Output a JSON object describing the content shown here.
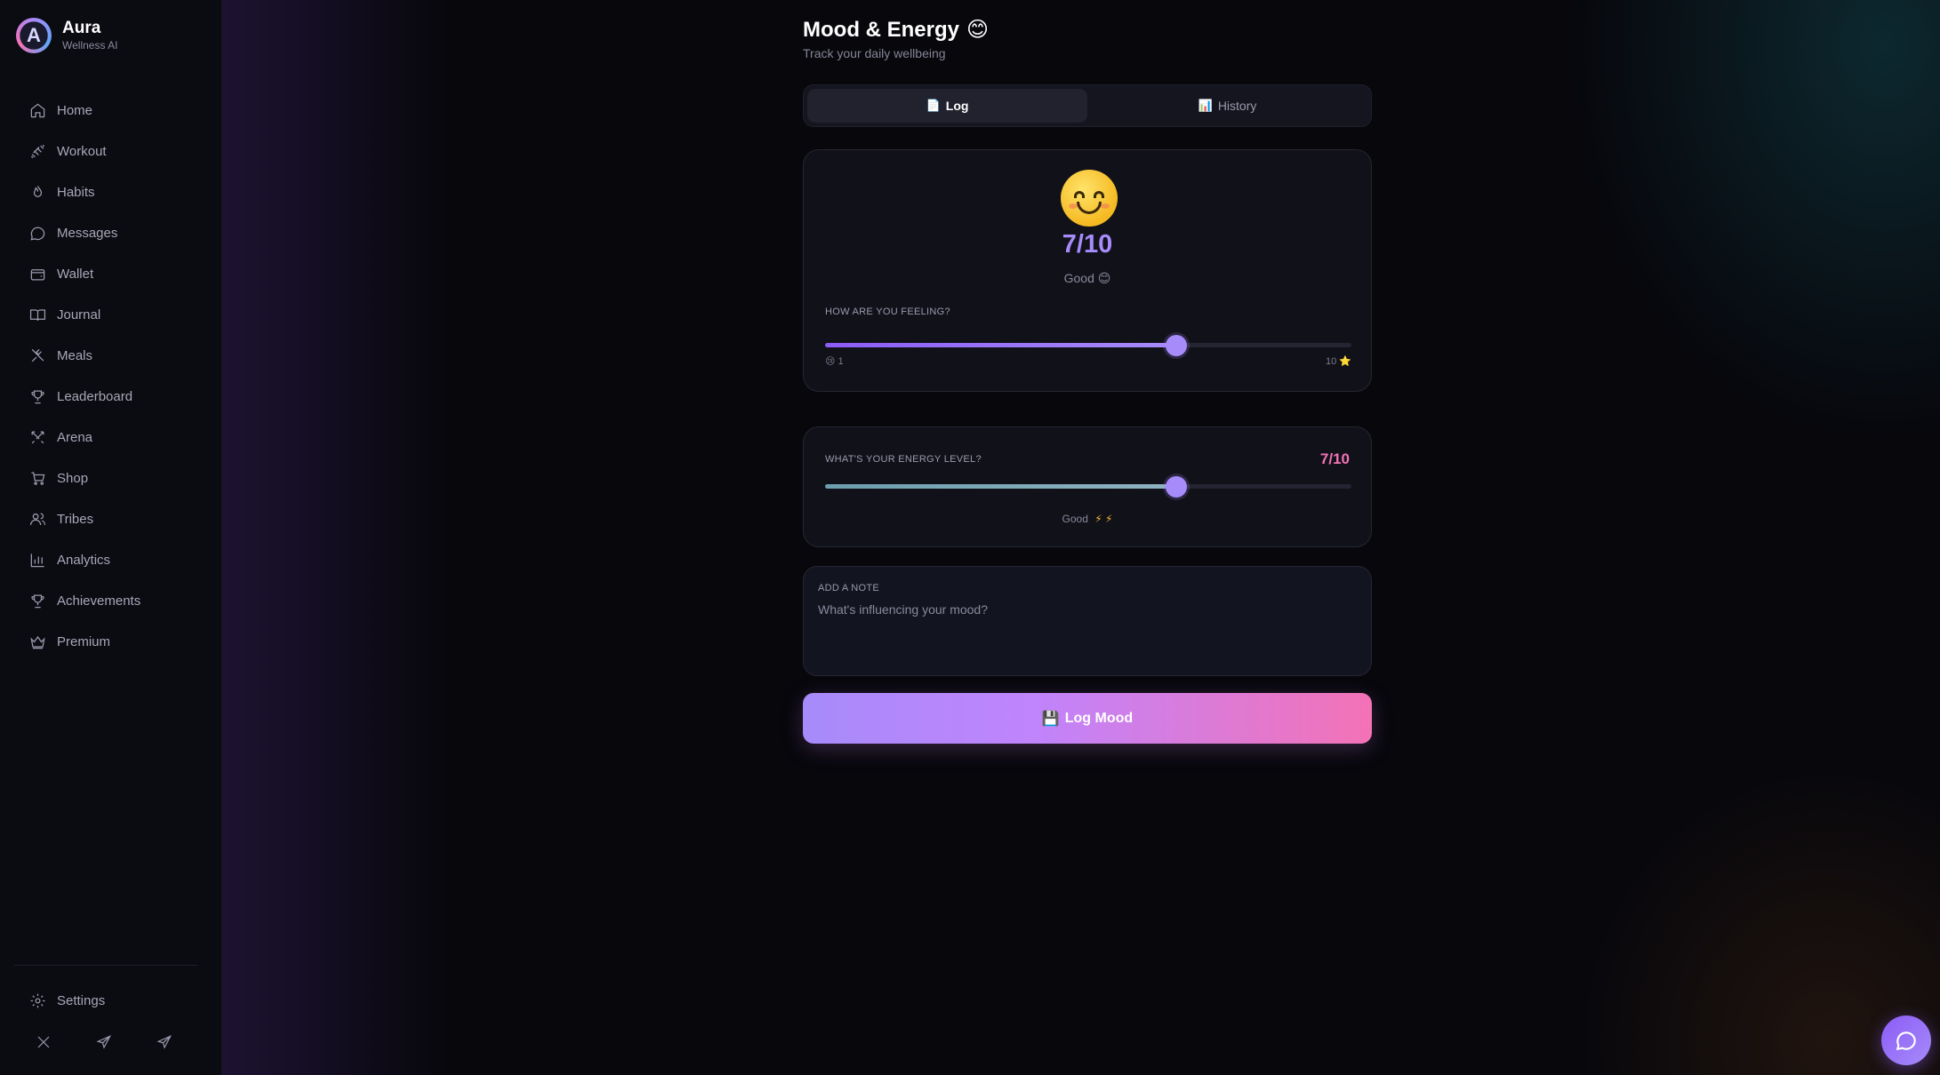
{
  "brand": {
    "name": "Aura",
    "subtitle": "Wellness AI",
    "logo_letter": "A"
  },
  "sidebar": {
    "items": [
      {
        "label": "Home",
        "icon": "home-icon"
      },
      {
        "label": "Workout",
        "icon": "dumbbell-icon"
      },
      {
        "label": "Habits",
        "icon": "flame-icon"
      },
      {
        "label": "Messages",
        "icon": "message-icon"
      },
      {
        "label": "Wallet",
        "icon": "wallet-icon"
      },
      {
        "label": "Journal",
        "icon": "book-icon"
      },
      {
        "label": "Meals",
        "icon": "utensils-icon"
      },
      {
        "label": "Leaderboard",
        "icon": "trophy-icon"
      },
      {
        "label": "Arena",
        "icon": "swords-icon"
      },
      {
        "label": "Shop",
        "icon": "cart-icon"
      },
      {
        "label": "Tribes",
        "icon": "users-icon"
      },
      {
        "label": "Analytics",
        "icon": "bar-chart-icon"
      },
      {
        "label": "Achievements",
        "icon": "trophy-icon"
      },
      {
        "label": "Premium",
        "icon": "crown-icon"
      }
    ],
    "settings_label": "Settings",
    "social": [
      "x-icon",
      "telegram-icon",
      "send-icon"
    ]
  },
  "page": {
    "title": "Mood & Energy",
    "title_emoji": "😊",
    "subtitle": "Track your daily wellbeing"
  },
  "tabs": [
    {
      "label": "Log",
      "icon": "📄",
      "active": true
    },
    {
      "label": "History",
      "icon": "📊",
      "active": false
    }
  ],
  "mood": {
    "score_text": "7/10",
    "value": 7,
    "min": 1,
    "max": 10,
    "label": "Good 😊",
    "question": "How are you feeling?",
    "min_label": "😢 1",
    "max_label": "10 ⭐"
  },
  "energy": {
    "question": "What's your energy level?",
    "score_text": "7/10",
    "value": 7,
    "min": 1,
    "max": 10,
    "label": "Good",
    "bolts": "⚡ ⚡"
  },
  "note": {
    "label": "Add a note",
    "placeholder": "What's influencing your mood?",
    "value": ""
  },
  "log_button": {
    "icon": "💾",
    "label": "Log Mood"
  },
  "colors": {
    "accent_purple": "#a78bfa",
    "accent_pink": "#f472b6",
    "background": "#07070c",
    "sidebar": "#0b0b12"
  }
}
